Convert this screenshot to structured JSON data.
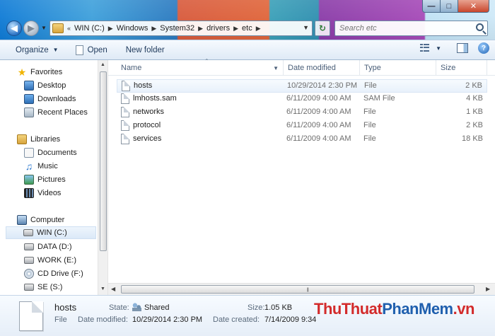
{
  "address_bar": {
    "overflow": "«",
    "breadcrumbs": [
      "WIN (C:)",
      "Windows",
      "System32",
      "drivers",
      "etc"
    ]
  },
  "search": {
    "placeholder": "Search etc"
  },
  "toolbar": {
    "organize": "Organize",
    "open": "Open",
    "new_folder": "New folder"
  },
  "nav_pane": {
    "favorites": {
      "label": "Favorites",
      "items": [
        "Desktop",
        "Downloads",
        "Recent Places"
      ]
    },
    "libraries": {
      "label": "Libraries",
      "items": [
        "Documents",
        "Music",
        "Pictures",
        "Videos"
      ]
    },
    "computer": {
      "label": "Computer",
      "drives": [
        "WIN (C:)",
        "DATA (D:)",
        "WORK (E:)",
        "CD Drive (F:)",
        "SE (S:)"
      ],
      "selected": "WIN (C:)"
    }
  },
  "columns": {
    "name": "Name",
    "date": "Date modified",
    "type": "Type",
    "size": "Size"
  },
  "files": [
    {
      "name": "hosts",
      "date": "10/29/2014 2:30 PM",
      "type": "File",
      "size": "2 KB",
      "selected": true
    },
    {
      "name": "lmhosts.sam",
      "date": "6/11/2009 4:00 AM",
      "type": "SAM File",
      "size": "4 KB"
    },
    {
      "name": "networks",
      "date": "6/11/2009 4:00 AM",
      "type": "File",
      "size": "1 KB"
    },
    {
      "name": "protocol",
      "date": "6/11/2009 4:00 AM",
      "type": "File",
      "size": "2 KB"
    },
    {
      "name": "services",
      "date": "6/11/2009 4:00 AM",
      "type": "File",
      "size": "18 KB"
    }
  ],
  "details": {
    "name": "hosts",
    "type": "File",
    "state_label": "State:",
    "state_value": "Shared",
    "date_modified_label": "Date modified:",
    "date_modified_value": "10/29/2014 2:30 PM",
    "size_label": "Size:",
    "size_value": "1.05 KB",
    "date_created_label": "Date created:",
    "date_created_value": "7/14/2009 9:34"
  },
  "watermark": {
    "part1": "ThuThuat",
    "part2": "PhanMem",
    "part3": ".vn"
  },
  "colors": {
    "selection": "#dbe9f8",
    "watermark_red": "#d32b2b",
    "watermark_blue": "#1f5fae"
  }
}
